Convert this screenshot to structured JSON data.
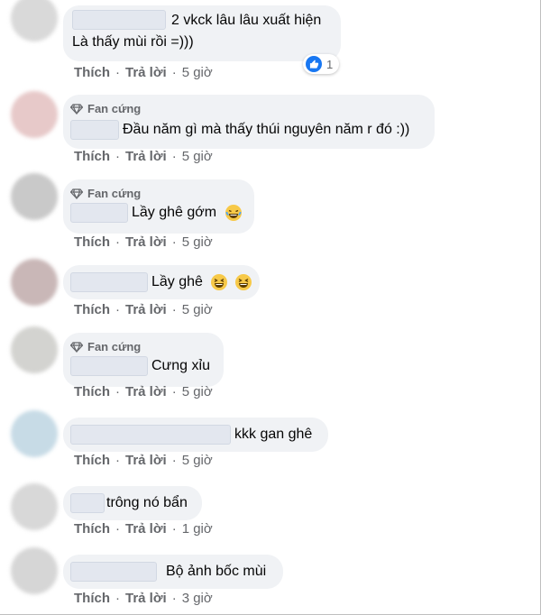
{
  "comments": [
    {
      "fan_badge": "",
      "text_line1": "2 vkck lâu lâu xuất hiện",
      "text_line2": "Là thấy mùi rồi =)))",
      "like": "Thích",
      "reply": "Trả lời",
      "time": "5 giờ",
      "reaction_count": "1",
      "avatar_color": "#d9d9d9"
    },
    {
      "fan_badge": "Fan cứng",
      "text": "Đầu năm gì mà thấy thúi nguyên năm r đó :))",
      "like": "Thích",
      "reply": "Trả lời",
      "time": "5 giờ",
      "avatar_color": "#e7c9c9"
    },
    {
      "fan_badge": "Fan cứng",
      "text": "Lầy ghê gớm",
      "emoji": "laughing-tears",
      "like": "Thích",
      "reply": "Trả lời",
      "time": "5 giờ",
      "avatar_color": "#c9c9c9"
    },
    {
      "fan_badge": "",
      "text": "Lầy ghê",
      "emoji": "grinning-squint x2",
      "like": "Thích",
      "reply": "Trả lời",
      "time": "5 giờ",
      "avatar_color": "#c9b7b7"
    },
    {
      "fan_badge": "Fan cứng",
      "text": "Cưng xỉu",
      "like": "Thích",
      "reply": "Trả lời",
      "time": "5 giờ",
      "avatar_color": "#d3d3d0"
    },
    {
      "fan_badge": "",
      "text": "kkk gan ghê",
      "like": "Thích",
      "reply": "Trả lời",
      "time": "5 giờ",
      "avatar_color": "#c7dbe6"
    },
    {
      "fan_badge": "",
      "text": "trông nó bẩn",
      "like": "Thích",
      "reply": "Trả lời",
      "time": "1 giờ",
      "avatar_color": "#d8d8d8"
    },
    {
      "fan_badge": "",
      "text": "Bộ ảnh bốc mùi",
      "like": "Thích",
      "reply": "Trả lời",
      "time": "3 giờ",
      "avatar_color": "#d6d6d6"
    }
  ],
  "colors": {
    "bubble": "#f0f2f5",
    "meta_text": "#65676b",
    "like_badge": "#1877f2"
  }
}
